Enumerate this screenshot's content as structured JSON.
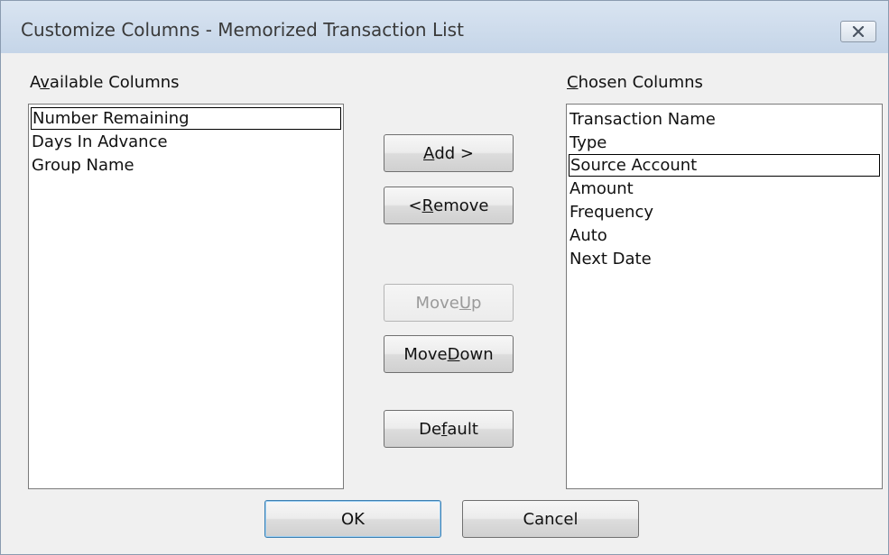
{
  "window": {
    "title": "Customize Columns - Memorized Transaction List",
    "close_icon": "close-icon"
  },
  "available": {
    "label_pre": "A",
    "label_mnemonic": "v",
    "label_post": "ailable Columns",
    "items": [
      "Number Remaining",
      "Days In Advance",
      "Group Name"
    ],
    "focused_index": 0
  },
  "chosen": {
    "label_pre": "",
    "label_mnemonic": "C",
    "label_post": "hosen Columns",
    "items": [
      "Transaction Name",
      "Type",
      "Source Account",
      "Amount",
      "Frequency",
      "Auto",
      "Next Date"
    ],
    "focused_index": 2
  },
  "buttons": {
    "add": {
      "pre": "",
      "mn": "A",
      "post": "dd >"
    },
    "remove": {
      "pre": "< ",
      "mn": "R",
      "post": "emove"
    },
    "move_up": {
      "pre": "Move ",
      "mn": "U",
      "post": "p"
    },
    "move_down": {
      "pre": "Move ",
      "mn": "D",
      "post": "own"
    },
    "default": {
      "pre": "De",
      "mn": "f",
      "post": "ault"
    },
    "ok": "OK",
    "cancel": "Cancel"
  },
  "colors": {
    "title_bar": "#c5d5e8",
    "dialog_bg": "#f0f0f0",
    "default_button_border": "#3c7fb1"
  }
}
